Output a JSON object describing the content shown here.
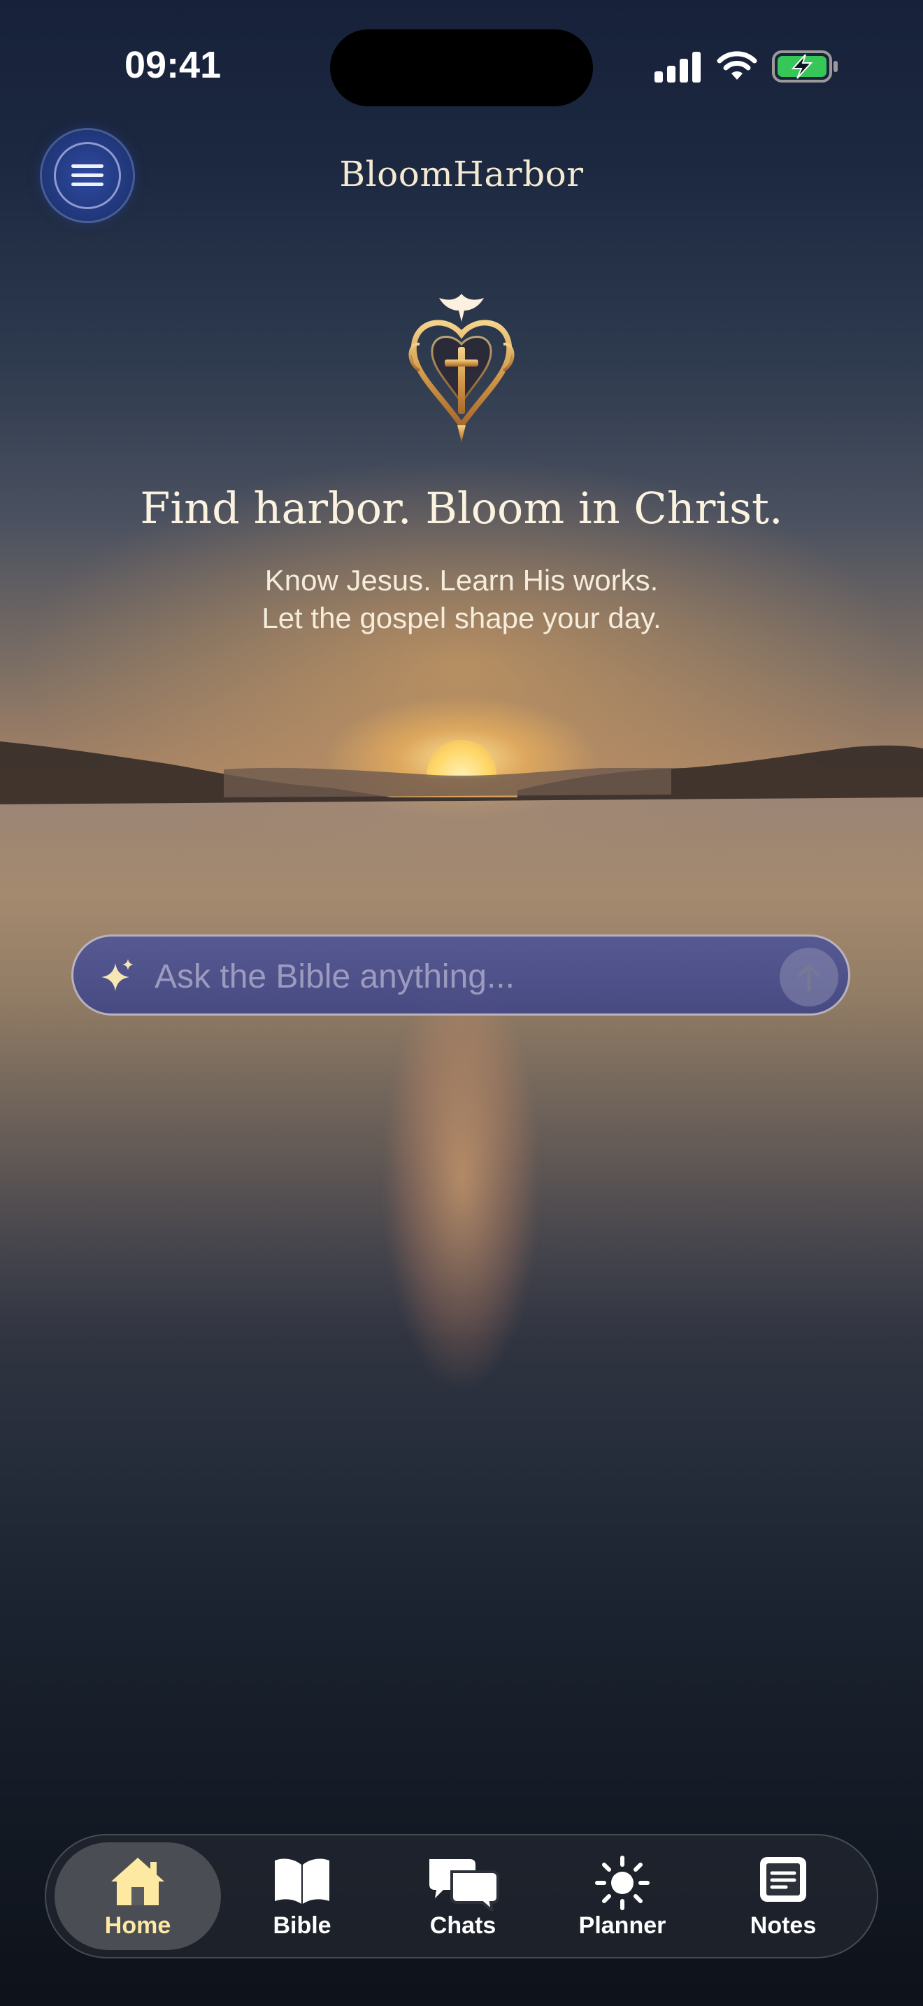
{
  "status_bar": {
    "time": "09:41"
  },
  "header": {
    "app_title": "BloomHarbor"
  },
  "hero": {
    "headline": "Find harbor. Bloom in Christ.",
    "subtitle_line1": "Know Jesus. Learn His works.",
    "subtitle_line2": "Let the gospel shape your day."
  },
  "ask": {
    "placeholder": "Ask the Bible anything..."
  },
  "tabbar": {
    "items": [
      {
        "label": "Home",
        "icon": "home-icon",
        "active": true
      },
      {
        "label": "Bible",
        "icon": "book-icon",
        "active": false
      },
      {
        "label": "Chats",
        "icon": "chat-bubbles-icon",
        "active": false
      },
      {
        "label": "Planner",
        "icon": "sun-icon",
        "active": false
      },
      {
        "label": "Notes",
        "icon": "note-icon",
        "active": false
      }
    ]
  },
  "colors": {
    "accent": "#fde9a2",
    "menu_button": "#22397f",
    "ask_bar": "#4c519a"
  }
}
